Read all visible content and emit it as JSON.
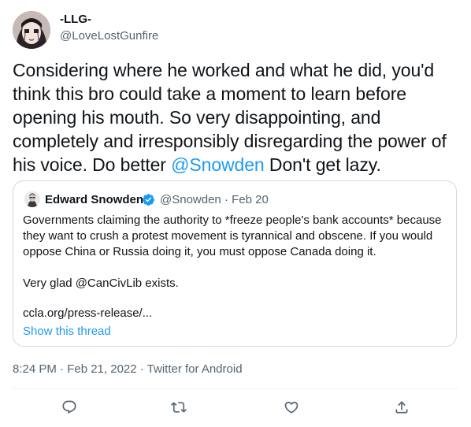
{
  "tweet": {
    "author_name": "-LLG-",
    "author_handle": "@LoveLostGunfire",
    "text_before_mention": "Considering where he worked and what he did, you'd think this bro could take a moment to learn before opening his mouth. So very disappointing, and completely and irresponsibly disregarding the power of his voice. Do better ",
    "mention": "@Snowden",
    "text_after_mention": " Don't get lazy.",
    "timestamp": "8:24 PM · Feb 21, 2022 · Twitter for Android"
  },
  "quoted_tweet": {
    "author_name": "Edward Snowden",
    "meta": "@Snowden · Feb 20",
    "paragraph1": "Governments claiming the authority to *freeze people's bank accounts* because they want to crush a protest movement is tyrannical and obscene. If you would oppose China or Russia doing it, you must oppose Canada doing it.",
    "paragraph2": "Very glad @CanCivLib exists.",
    "link": "ccla.org/press-release/...",
    "show_thread": "Show this thread"
  },
  "actions": {
    "reply_icon": "reply-icon",
    "retweet_icon": "retweet-icon",
    "like_icon": "like-icon",
    "share_icon": "share-icon"
  },
  "colors": {
    "accent": "#1d9bf0",
    "text": "#0f1419",
    "secondary": "#536471",
    "border": "#cfd9de"
  }
}
